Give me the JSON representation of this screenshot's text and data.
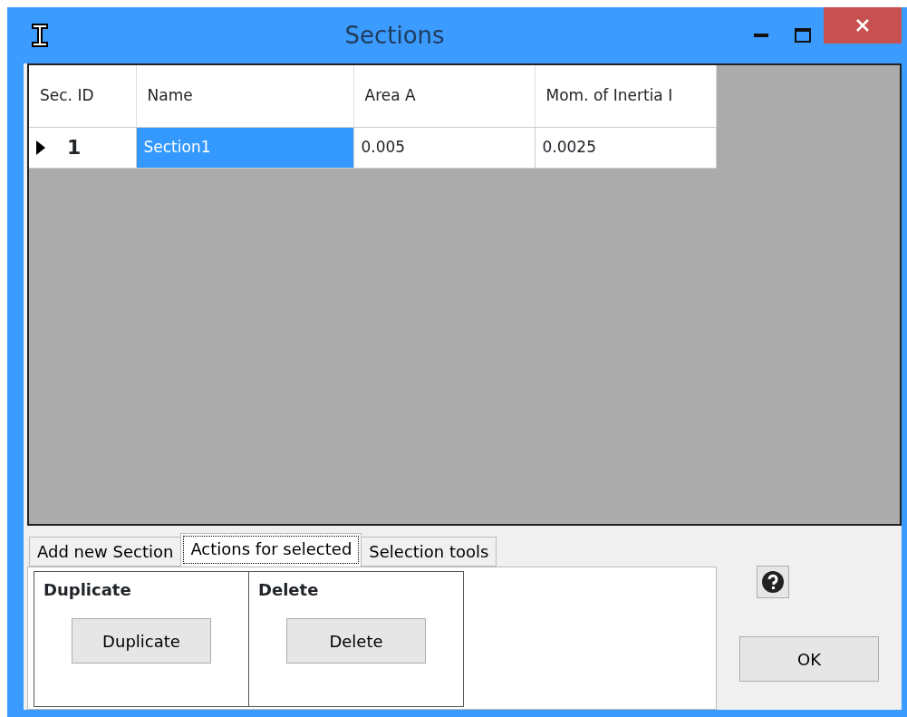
{
  "window": {
    "title": "Sections"
  },
  "table": {
    "columns": [
      "Sec. ID",
      "Name",
      "Area A",
      "Mom. of Inertia I"
    ],
    "rows": [
      {
        "current": true,
        "cells": [
          {
            "text": "1",
            "selected": false
          },
          {
            "text": "Section1",
            "selected": true
          },
          {
            "text": "0.005",
            "selected": false
          },
          {
            "text": "0.0025",
            "selected": false
          }
        ]
      }
    ]
  },
  "tabs": [
    {
      "label": "Add new Section",
      "selected": false
    },
    {
      "label": "Actions for selected",
      "selected": true
    },
    {
      "label": "Selection tools",
      "selected": false
    }
  ],
  "groups": [
    {
      "title": "Duplicate",
      "button": "Duplicate"
    },
    {
      "title": "Delete",
      "button": "Delete"
    }
  ],
  "ok_button": "OK"
}
